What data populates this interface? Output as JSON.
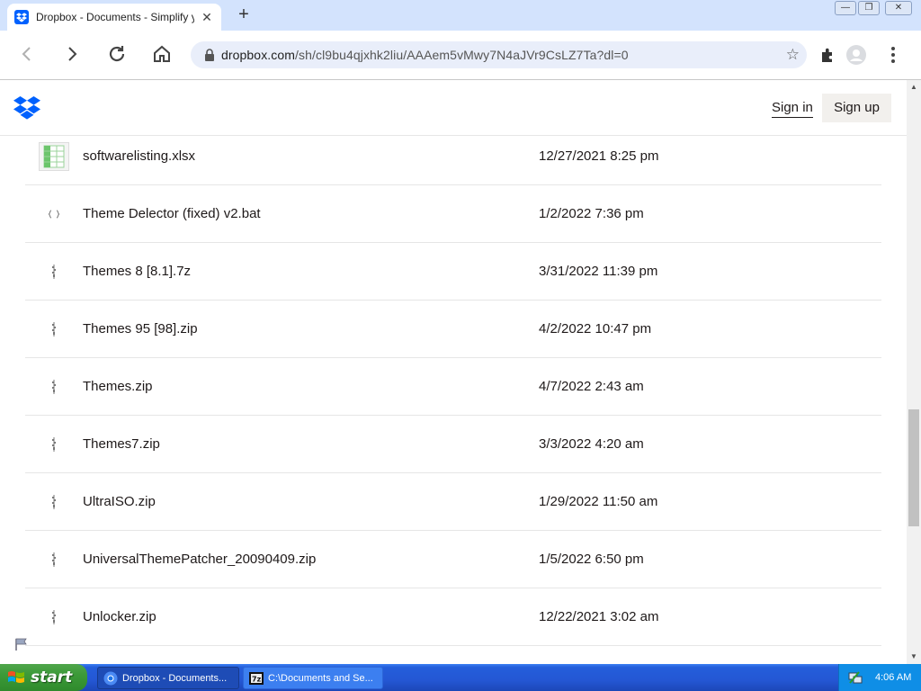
{
  "browser": {
    "tab_title": "Dropbox - Documents - Simplify your",
    "tab_close": "✕",
    "new_tab": "+",
    "window_buttons": [
      "—",
      "❐",
      "✕"
    ],
    "url_host": "dropbox.com",
    "url_path": "/sh/cl9bu4qjxhk2liu/AAAem5vMwy7N4aJVr9CsLZ7Ta?dl=0",
    "star": "☆"
  },
  "header": {
    "sign_in": "Sign in",
    "sign_up": "Sign up"
  },
  "files": [
    {
      "name": "softwarelisting.xlsx",
      "date": "12/27/2021 8:25 pm",
      "icon": "spreadsheet-icon"
    },
    {
      "name": "Theme Delector (fixed) v2.bat",
      "date": "1/2/2022 7:36 pm",
      "icon": "code-icon"
    },
    {
      "name": "Themes 8 [8.1].7z",
      "date": "3/31/2022 11:39 pm",
      "icon": "zip-icon"
    },
    {
      "name": "Themes 95 [98].zip",
      "date": "4/2/2022 10:47 pm",
      "icon": "zip-icon"
    },
    {
      "name": "Themes.zip",
      "date": "4/7/2022 2:43 am",
      "icon": "zip-icon"
    },
    {
      "name": "Themes7.zip",
      "date": "3/3/2022 4:20 am",
      "icon": "zip-icon"
    },
    {
      "name": "UltraISO.zip",
      "date": "1/29/2022 11:50 am",
      "icon": "zip-icon"
    },
    {
      "name": "UniversalThemePatcher_20090409.zip",
      "date": "1/5/2022 6:50 pm",
      "icon": "zip-icon"
    },
    {
      "name": "Unlocker.zip",
      "date": "12/22/2021 3:02 am",
      "icon": "zip-icon"
    }
  ],
  "taskbar": {
    "start_label": "start",
    "tasks": [
      {
        "label": "Dropbox - Documents...",
        "icon": "chrome-icon",
        "active": true
      },
      {
        "label": "C:\\Documents and Se...",
        "icon": "7zip-icon",
        "active": false
      }
    ],
    "clock": "4:06 AM"
  },
  "colors": {
    "dropbox_blue": "#0061fe",
    "tabstrip": "#d3e3fd",
    "xp_taskbar": "#245edb",
    "xp_start_green": "#3c9a38"
  }
}
